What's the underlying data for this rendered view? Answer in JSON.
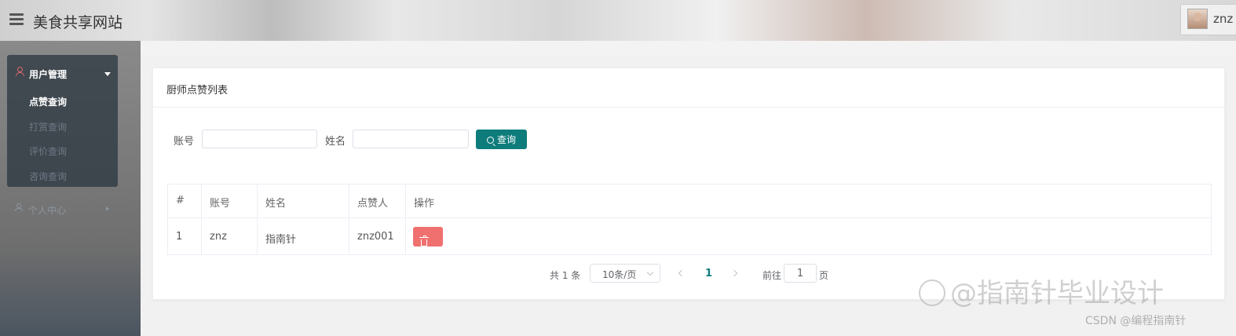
{
  "header": {
    "site_title": "美食共享网站",
    "username": "znz"
  },
  "sidebar": {
    "group_label": "用户管理",
    "items": [
      {
        "label": "点赞查询",
        "active": true
      },
      {
        "label": "打赏查询",
        "active": false
      },
      {
        "label": "评价查询",
        "active": false
      },
      {
        "label": "咨询查询",
        "active": false
      }
    ],
    "personal_label": "个人中心"
  },
  "card": {
    "title": "厨师点赞列表"
  },
  "search": {
    "account_label": "账号",
    "account_value": "",
    "name_label": "姓名",
    "name_value": "",
    "button_label": "查询"
  },
  "table": {
    "columns": [
      "#",
      "账号",
      "姓名",
      "点赞人",
      "操作"
    ],
    "rows": [
      {
        "index": "1",
        "account": "znz",
        "name": "指南针",
        "liker": "znz001"
      }
    ]
  },
  "pagination": {
    "total": "共 1 条",
    "page_size": "10条/页",
    "current_page": "1",
    "goto_label": "前往",
    "goto_value": "1",
    "page_suffix": "页"
  },
  "watermark": {
    "main": "@指南针毕业设计",
    "sub": "CSDN @编程指南针"
  },
  "colors": {
    "accent": "#0e7c7b",
    "danger": "#f07070",
    "sidebar_active_icon": "#e06a6a"
  },
  "icons": [
    "menu-icon",
    "user-icon",
    "chevron-down-icon",
    "chevron-right-icon",
    "search-icon",
    "trash-icon"
  ]
}
